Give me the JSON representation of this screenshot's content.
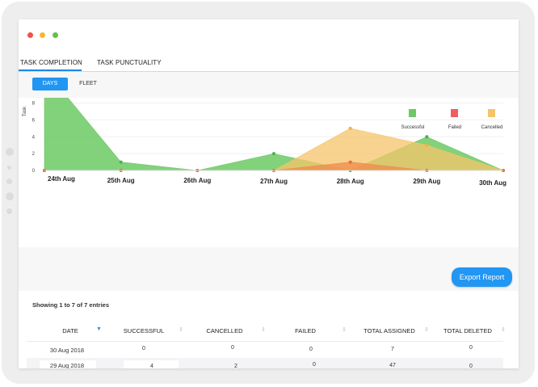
{
  "window": {
    "controls": {
      "close_color": "#f0524a",
      "minimize_color": "#f5b82e",
      "maximize_color": "#5fc341"
    }
  },
  "tabs": [
    {
      "label": "TASK COMPLETION",
      "active": true
    },
    {
      "label": "TASK PUNCTUALITY",
      "active": false
    }
  ],
  "toggle": {
    "days_label": "DAYS",
    "fleet_label": "FLEET",
    "selected": "DAYS"
  },
  "legend": [
    {
      "label": "Successful",
      "color": "#6cc964"
    },
    {
      "label": "Failed",
      "color": "#ee5f5f"
    },
    {
      "label": "Cancelled",
      "color": "#f5c46a"
    }
  ],
  "chart_data": {
    "type": "area",
    "ylabel": "Task",
    "xlabel": "",
    "ylim": [
      0,
      14
    ],
    "yticks": [
      0,
      2,
      4,
      6,
      8,
      10,
      12,
      14
    ],
    "categories": [
      "24th Aug",
      "25th Aug",
      "26th Aug",
      "27th Aug",
      "28th Aug",
      "29th Aug",
      "30th Aug"
    ],
    "series": [
      {
        "name": "Successful",
        "values": [
          12,
          1,
          0,
          2,
          0,
          4,
          0
        ]
      },
      {
        "name": "Cancelled",
        "values": [
          0,
          0,
          0,
          0,
          5,
          3,
          0
        ]
      },
      {
        "name": "Failed",
        "values": [
          0,
          0,
          0,
          0,
          1,
          0,
          0
        ]
      }
    ],
    "legend_position": "top-right",
    "grid": true
  },
  "export_label": "Export Report",
  "table": {
    "showing_text": "Showing 1 to 7 of 7 entries",
    "columns": [
      "DATE",
      "SUCCESSFUL",
      "CANCELLED",
      "FAILED",
      "TOTAL ASSIGNED",
      "TOTAL DELETED"
    ],
    "sort_arrow_active": "▼",
    "sort_arrow": "⇕",
    "rows": [
      {
        "date": "30 Aug 2018",
        "successful": "0",
        "cancelled": "0",
        "failed": "0",
        "total_assigned": "7",
        "total_deleted": "0"
      },
      {
        "date": "29 Aug 2018",
        "successful": "4",
        "cancelled": "2",
        "failed": "0",
        "total_assigned": "47",
        "total_deleted": "0"
      }
    ]
  }
}
